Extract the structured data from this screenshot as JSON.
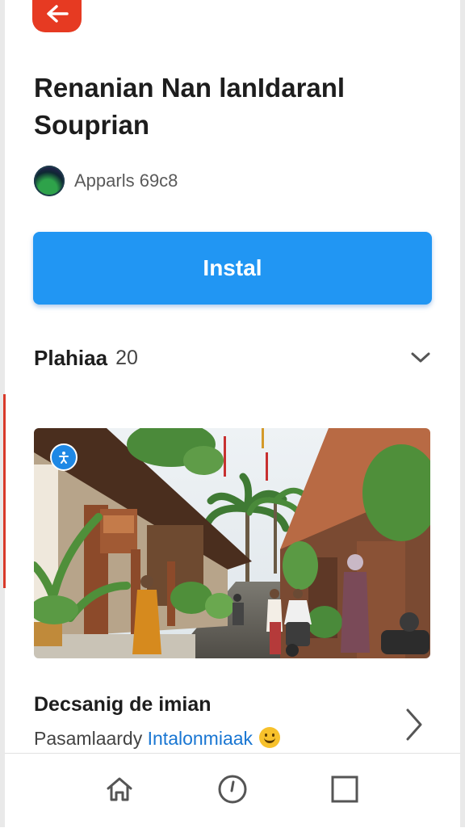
{
  "header": {
    "back_icon": "arrow-left-icon",
    "back_color": "#e63a22",
    "title_line1": "Renanian Nan lanIdaranl",
    "title_line2": "Souprian"
  },
  "developer": {
    "logo_icon": "developer-logo",
    "name": "Apparls 69c8"
  },
  "install": {
    "label": "Instal",
    "color": "#2196f3"
  },
  "version": {
    "label": "Plahiaa",
    "number": "20",
    "toggle_icon": "chevron-down-icon"
  },
  "screenshot": {
    "badge_icon": "accessibility-icon"
  },
  "description": {
    "title": "Decsanig de imian",
    "text": "Pasamlaardy",
    "link": "Intalonmiaak",
    "emoji": "smiley-emoji",
    "more_icon": "chevron-right-icon"
  },
  "bottom_nav": [
    {
      "icon": "home-icon"
    },
    {
      "icon": "clock-icon"
    },
    {
      "icon": "square-icon"
    }
  ]
}
